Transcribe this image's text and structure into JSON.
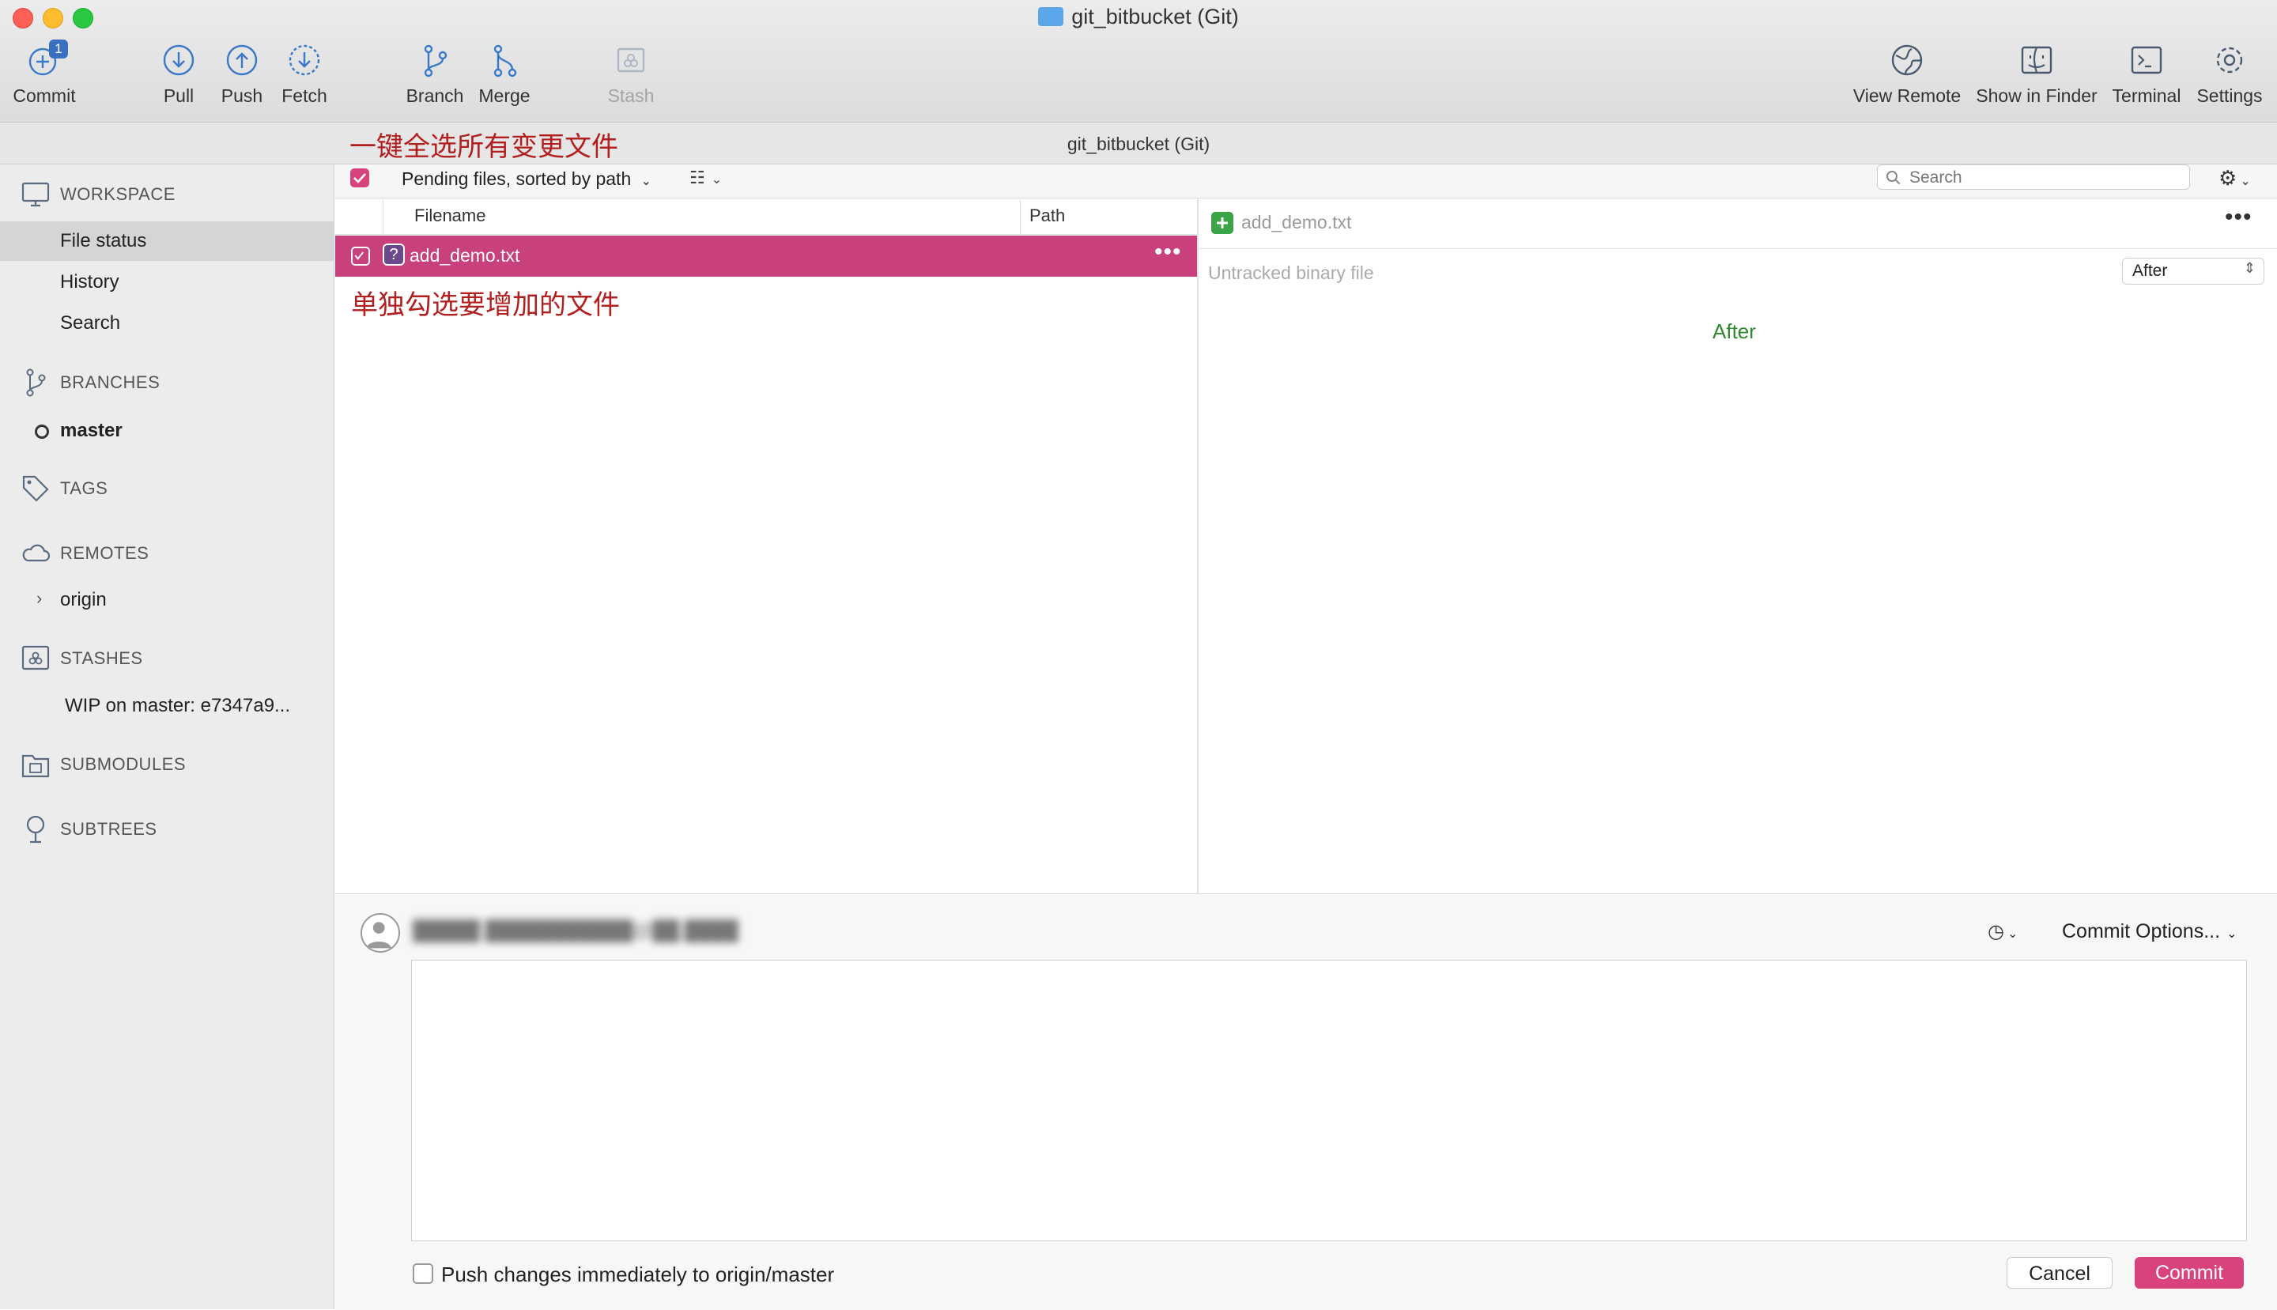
{
  "window": {
    "title": "git_bitbucket (Git)"
  },
  "toolbar": {
    "commit": {
      "label": "Commit",
      "badge": "1"
    },
    "pull": "Pull",
    "push": "Push",
    "fetch": "Fetch",
    "branch": "Branch",
    "merge": "Merge",
    "stash": "Stash",
    "view_remote": "View Remote",
    "show_in_finder": "Show in Finder",
    "terminal": "Terminal",
    "settings": "Settings"
  },
  "path_title": "git_bitbucket (Git)",
  "annotations": {
    "select_all": "一键全选所有变更文件",
    "select_single": "单独勾选要增加的文件"
  },
  "sidebar": {
    "workspace": {
      "label": "WORKSPACE",
      "items": [
        "File status",
        "History",
        "Search"
      ],
      "selected": "File status"
    },
    "branches": {
      "label": "BRANCHES",
      "items": [
        "master"
      ]
    },
    "tags": {
      "label": "TAGS"
    },
    "remotes": {
      "label": "REMOTES",
      "items": [
        "origin"
      ]
    },
    "stashes": {
      "label": "STASHES",
      "items": [
        "WIP on master: e7347a9..."
      ]
    },
    "submodules": {
      "label": "SUBMODULES"
    },
    "subtrees": {
      "label": "SUBTREES"
    }
  },
  "file_list": {
    "all_checked": true,
    "sort_label": "Pending files, sorted by path",
    "search_placeholder": "Search",
    "columns": [
      "Filename",
      "Path"
    ],
    "rows": [
      {
        "checked": true,
        "status": "?",
        "filename": "add_demo.txt",
        "path": ""
      }
    ]
  },
  "diff": {
    "filename": "add_demo.txt",
    "message": "Untracked binary file",
    "view_select": "After",
    "after_label": "After"
  },
  "commit": {
    "author_redacted": "█████ ███████████@██.████",
    "options_label": "Commit Options...",
    "push_label": "Push changes immediately to origin/master",
    "push_checked": false,
    "cancel_label": "Cancel",
    "commit_label": "Commit"
  },
  "colors": {
    "accent": "#d8437e",
    "row_selected": "#c8417d",
    "annotation": "#b11f1f",
    "add_icon": "#3aa447",
    "after_text": "#2f8a2f"
  }
}
